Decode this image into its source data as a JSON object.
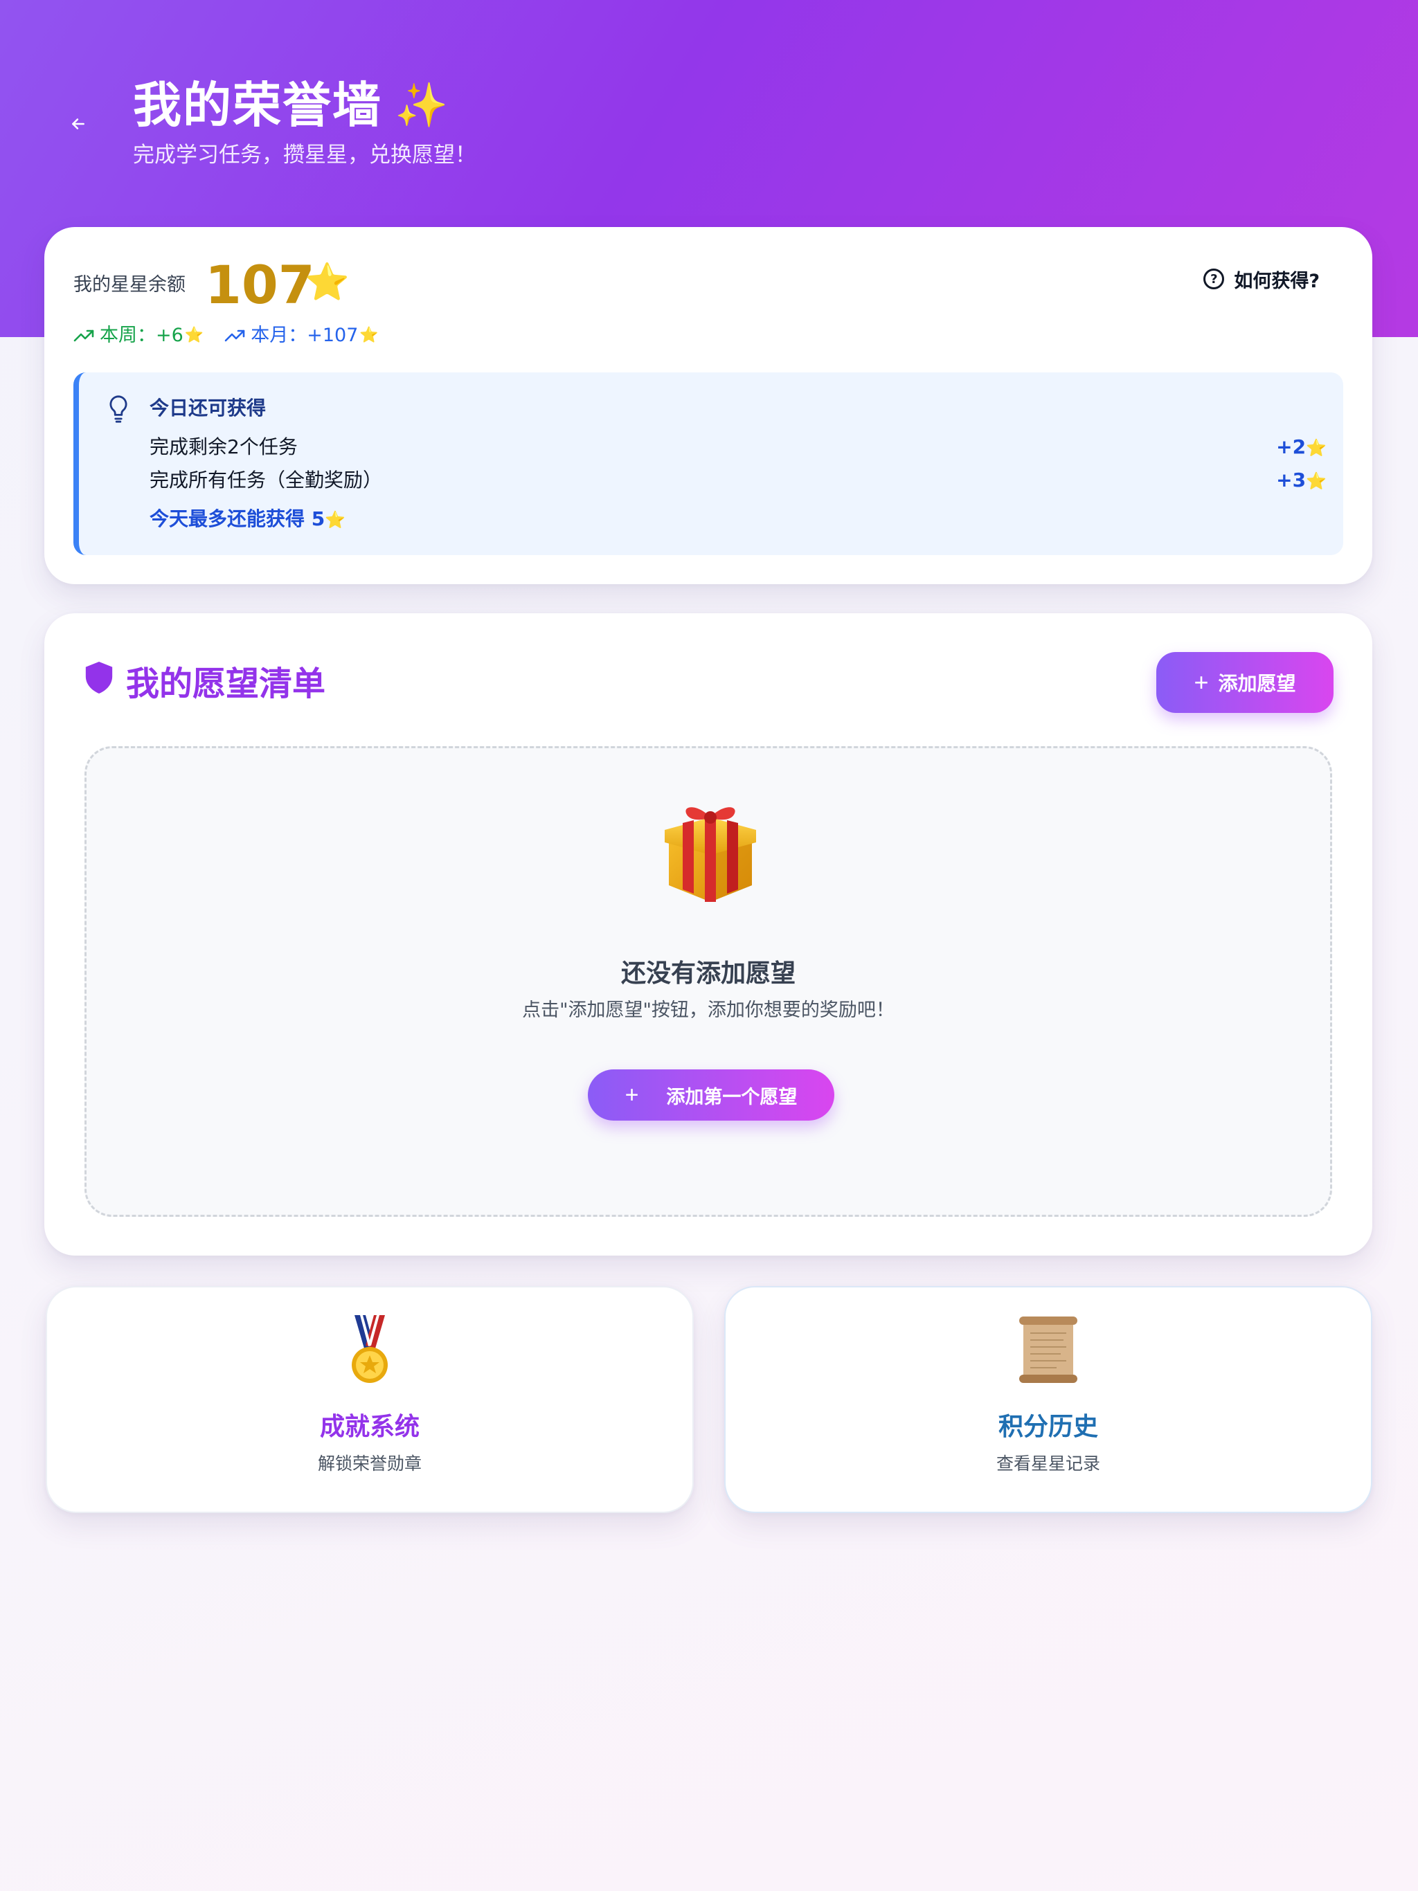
{
  "header": {
    "title": "我的荣誉墙",
    "title_emoji": "✨",
    "subtitle": "完成学习任务，攒星星，兑换愿望！"
  },
  "balance": {
    "label": "我的星星余额",
    "value": "107",
    "star": "⭐",
    "how_label": "如何获得?",
    "week_label": "本周：",
    "week_value": "+6",
    "month_label": "本月：",
    "month_value": "+107"
  },
  "today_tip": {
    "title": "今日还可获得",
    "items": [
      {
        "label": "完成剩余2个任务",
        "value": "+2"
      },
      {
        "label": "完成所有任务（全勤奖励）",
        "value": "+3"
      }
    ],
    "max_text": "今天最多还能获得 5"
  },
  "wishlist": {
    "title": "我的愿望清单",
    "add_button": "添加愿望",
    "empty_title": "还没有添加愿望",
    "empty_sub": "点击\"添加愿望\"按钮，添加你想要的奖励吧！",
    "first_button": "添加第一个愿望"
  },
  "features": [
    {
      "title": "成就系统",
      "sub": "解锁荣誉勋章",
      "icon": "medal-icon"
    },
    {
      "title": "积分历史",
      "sub": "查看星星记录",
      "icon": "scroll-icon"
    }
  ],
  "colors": {
    "hero_start": "#9254f0",
    "hero_end": "#b53ae3",
    "star_gold": "#c5900f",
    "accent_purple": "#9333ea",
    "accent_blue": "#1d4ed8",
    "success_green": "#16a34a"
  }
}
